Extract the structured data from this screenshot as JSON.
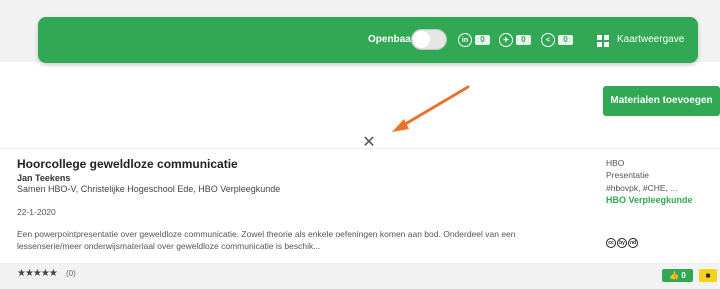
{
  "toolbar": {
    "public_label": "Openbaar",
    "public_toggle_on": false,
    "share": [
      {
        "icon": "linkedin-icon",
        "glyph": "in",
        "count": "0"
      },
      {
        "icon": "twitter-icon",
        "glyph": "✈",
        "count": "0"
      },
      {
        "icon": "share-icon",
        "glyph": "<",
        "count": "0"
      }
    ],
    "map_view_label": "Kaartweergave"
  },
  "add_materials_label": "Materialen toevoegen",
  "close_glyph": "✕",
  "material": {
    "title": "Hoorcollege geweldloze communicatie",
    "author": "Jan Teekens",
    "orgs": "Samen HBO-V, Christelijke Hogeschool Ede, HBO Verpleegkunde",
    "date": "22-1-2020",
    "description": "Een powerpointpresentatie over geweldloze communicatie. Zowel theorie als enkele oefeningen komen aan bod. Onderdeel van een lessenserie/meer onderwijsmateriaal over geweldloze communicatie is beschik...",
    "level": "HBO",
    "type": "Presentatie",
    "tags": "#hbovpk, #CHE, ...",
    "org": "HBO Verpleegkunde",
    "license_icons": [
      "cc",
      "by",
      "nd"
    ]
  },
  "footer": {
    "stars": "★★★★★",
    "rating_count": "(0)",
    "like_label": "0",
    "like_glyph": "👍"
  },
  "colors": {
    "accent": "#31a853",
    "background": "#f2f2f2",
    "save": "#f5d316",
    "arrow": "#e8732a"
  }
}
